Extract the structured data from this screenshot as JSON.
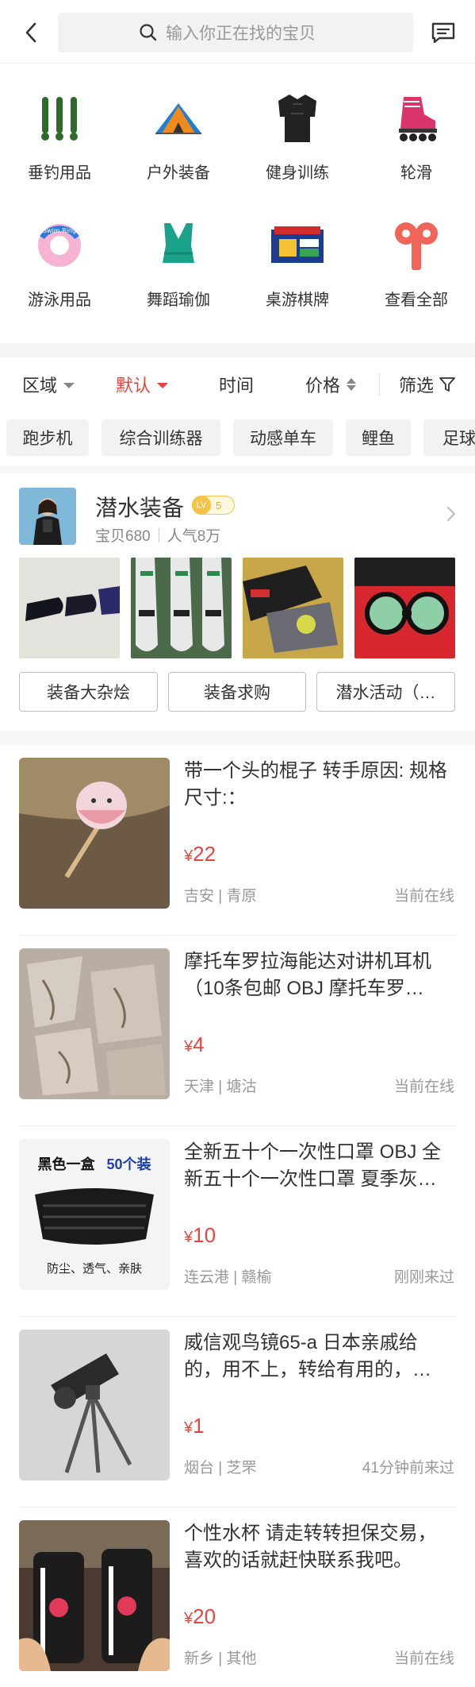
{
  "header": {
    "back_icon": "chevron-left-icon",
    "search_placeholder": "输入你正在找的宝贝",
    "message_icon": "message-icon"
  },
  "categories": [
    {
      "label": "垂钓用品",
      "icon": "fishing-floats-icon"
    },
    {
      "label": "户外装备",
      "icon": "tent-icon"
    },
    {
      "label": "健身训练",
      "icon": "sport-shirt-icon"
    },
    {
      "label": "轮滑",
      "icon": "roller-skate-icon"
    },
    {
      "label": "游泳用品",
      "icon": "swim-ring-icon"
    },
    {
      "label": "舞蹈瑜伽",
      "icon": "sports-bra-icon"
    },
    {
      "label": "桌游棋牌",
      "icon": "board-game-icon"
    },
    {
      "label": "查看全部",
      "icon": "windup-key-icon"
    }
  ],
  "filters": {
    "region": "区域",
    "default": "默认",
    "time": "时间",
    "price": "价格",
    "filter": "筛选"
  },
  "tags": [
    "跑步机",
    "综合训练器",
    "动感单车",
    "鲤鱼",
    "足球"
  ],
  "pond": {
    "title": "潜水装备",
    "level_prefix": "LV",
    "level": "5",
    "items_count": "宝贝680",
    "popularity": "人气8万",
    "buttons": [
      "装备大杂烩",
      "装备求购",
      "潜水活动（…"
    ]
  },
  "items": [
    {
      "title": "带一个头的棍子 转手原因: 规格尺寸:：",
      "currency": "¥",
      "price": "22",
      "location": "吉安 | 青原",
      "status": "当前在线"
    },
    {
      "title": "摩托车罗拉海能达对讲机耳机 （10条包邮 OBJ 摩托车罗…",
      "currency": "¥",
      "price": "4",
      "location": "天津 | 塘沽",
      "status": "当前在线"
    },
    {
      "title": "全新五十个一次性口罩 OBJ 全新五十个一次性口罩 夏季灰…",
      "currency": "¥",
      "price": "10",
      "location": "连云港 | 赣榆",
      "status": "刚刚来过",
      "thumb_text_1": "黑色一盒",
      "thumb_text_2": "50个装",
      "thumb_text_3": "防尘、透气、亲肤"
    },
    {
      "title": "威信观鸟镜65-a 日本亲戚给的，用不上，转给有用的，…",
      "currency": "¥",
      "price": "1",
      "location": "烟台 | 芝罘",
      "status": "41分钟前来过"
    },
    {
      "title": "个性水杯 请走转转担保交易，喜欢的话就赶快联系我吧。",
      "currency": "¥",
      "price": "20",
      "location": "新乡 | 其他",
      "status": "当前在线"
    }
  ],
  "colors": {
    "accent": "#e8433d",
    "background_gap": "#f4f4f4",
    "text": "#333333",
    "muted": "#999999"
  }
}
